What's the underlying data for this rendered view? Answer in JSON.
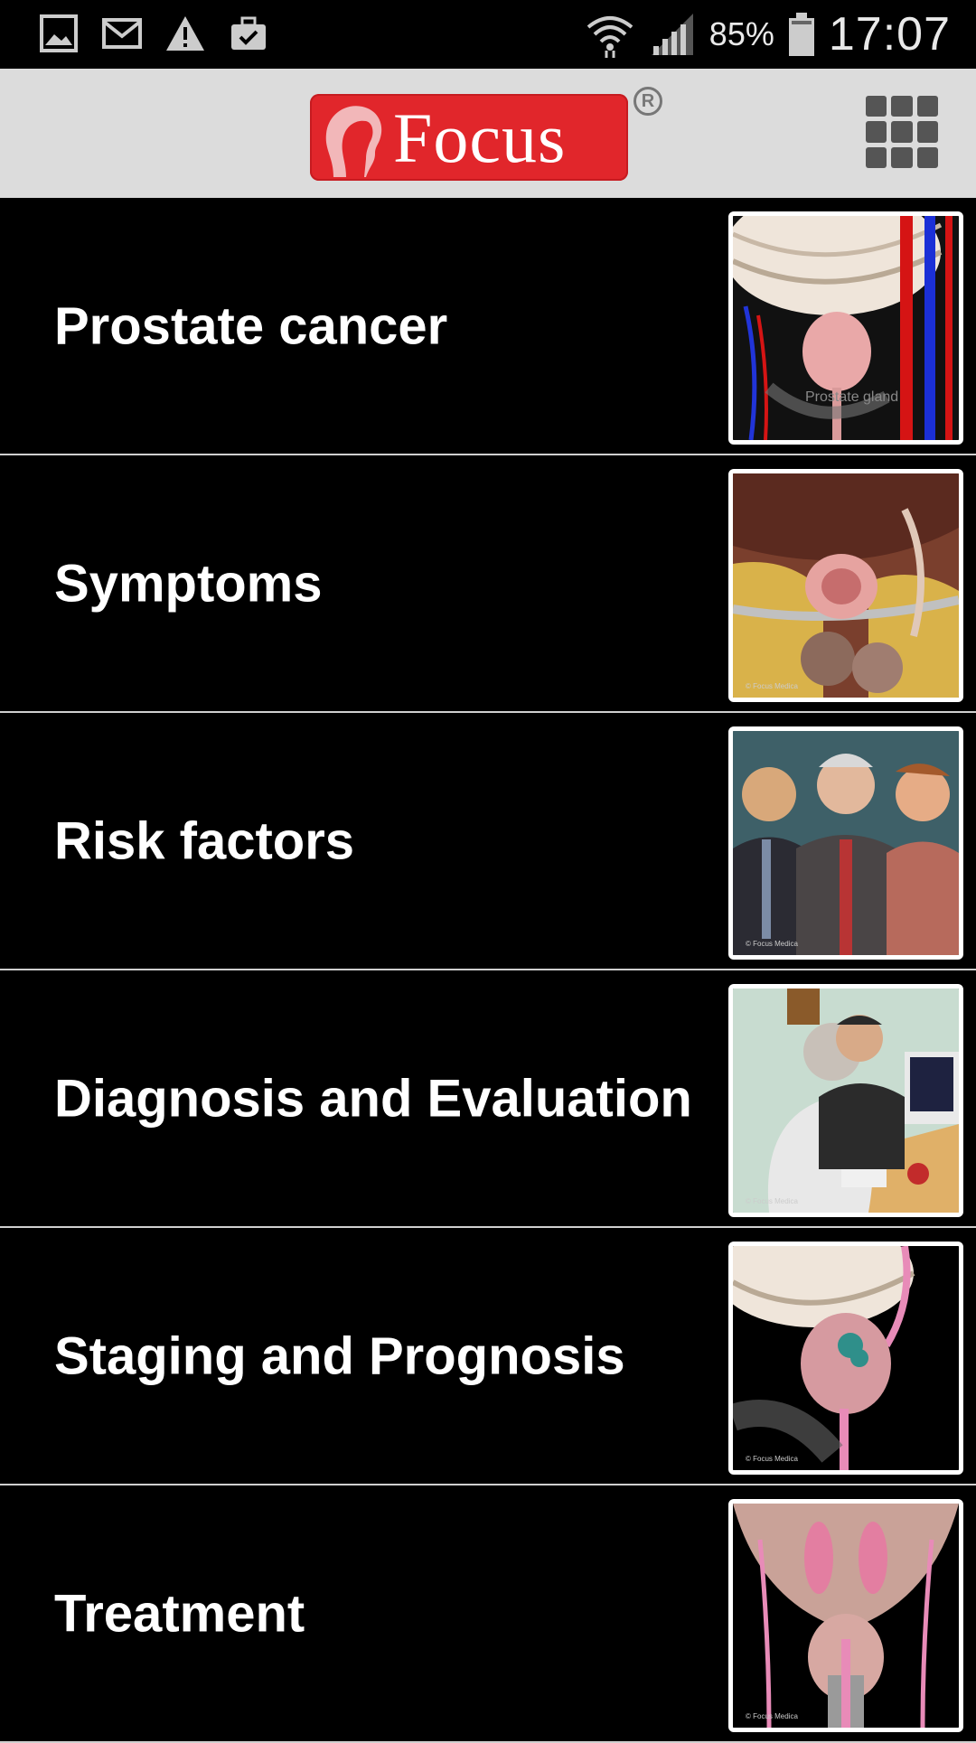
{
  "status_bar": {
    "battery_percent": "85%",
    "time": "17:07",
    "icons": [
      "gallery-icon",
      "gmail-icon",
      "warning-icon",
      "briefcase-check-icon",
      "wifi-icon",
      "signal-icon",
      "battery-icon"
    ]
  },
  "header": {
    "logo_text": "Focus",
    "logo_registered": "R",
    "menu_icon": "grid-menu-icon"
  },
  "topics": [
    {
      "label": "Prostate cancer",
      "thumb_caption": "Prostate gland",
      "thumb_watermark": ""
    },
    {
      "label": "Symptoms",
      "thumb_caption": "",
      "thumb_watermark": "© Focus Medica"
    },
    {
      "label": "Risk factors",
      "thumb_caption": "",
      "thumb_watermark": "© Focus Medica"
    },
    {
      "label": "Diagnosis and Evaluation",
      "thumb_caption": "",
      "thumb_watermark": "© Focus Medica"
    },
    {
      "label": "Staging and Prognosis",
      "thumb_caption": "",
      "thumb_watermark": "© Focus Medica"
    },
    {
      "label": "Treatment",
      "thumb_caption": "",
      "thumb_watermark": "© Focus Medica"
    }
  ],
  "colors": {
    "logo_red": "#e1262b",
    "header_bg": "#dcdcdc",
    "list_bg": "#000000",
    "divider": "#cfcfcf"
  }
}
